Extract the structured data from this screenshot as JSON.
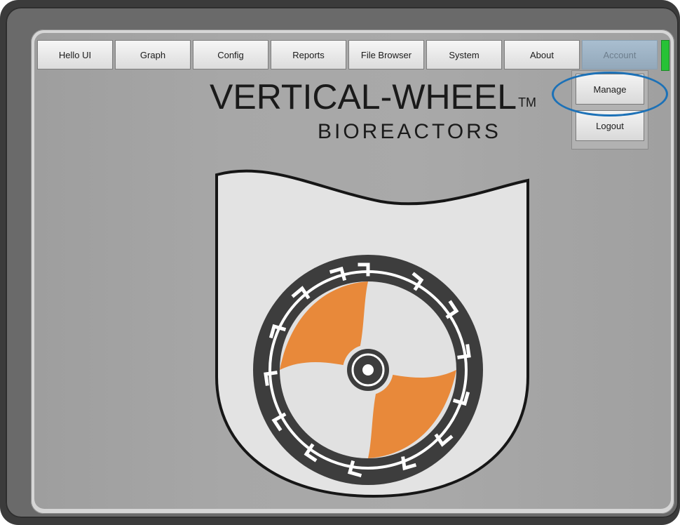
{
  "tabs": [
    {
      "label": "Hello UI"
    },
    {
      "label": "Graph"
    },
    {
      "label": "Config"
    },
    {
      "label": "Reports"
    },
    {
      "label": "File Browser"
    },
    {
      "label": "System"
    },
    {
      "label": "About"
    },
    {
      "label": "Account",
      "selected": true
    }
  ],
  "account_menu": {
    "items": [
      {
        "label": "Manage"
      },
      {
        "label": "Logout"
      }
    ],
    "highlighted_item": "Manage"
  },
  "logo": {
    "title": "VERTICAL-WHEEL",
    "trademark": "TM",
    "subtitle": "BIOREACTORS"
  },
  "colors": {
    "status_led": "#27c236",
    "highlight_ring": "#1c71b7",
    "impeller_orange": "#e8893a",
    "wheel_dark": "#3d3d3d"
  }
}
